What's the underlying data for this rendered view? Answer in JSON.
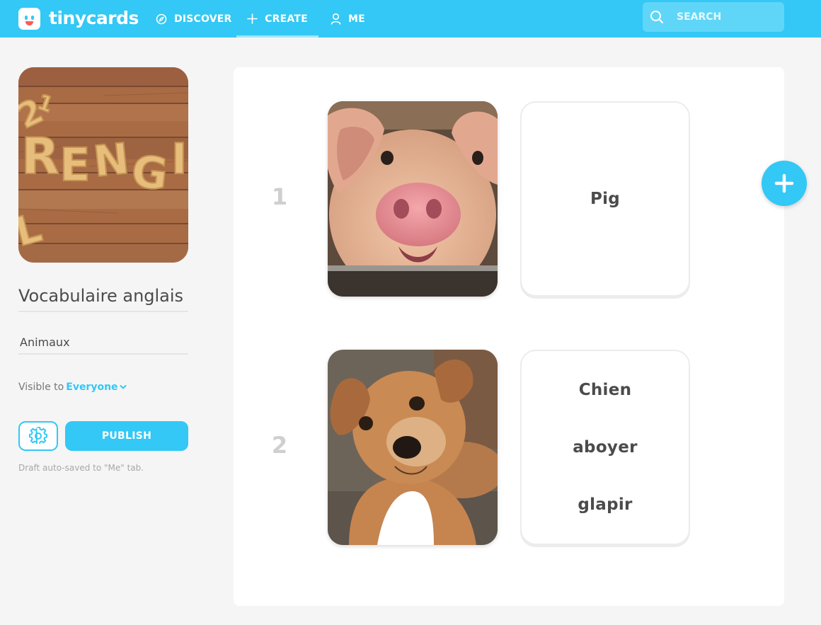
{
  "app": {
    "name": "tinycards"
  },
  "nav": {
    "discover": "DISCOVER",
    "create": "CREATE",
    "me": "ME"
  },
  "search": {
    "placeholder": "SEARCH"
  },
  "deck": {
    "cover_icon": "wooden-letters-english-image",
    "title": "Vocabulaire anglais",
    "description": "Animaux",
    "visible_label": "Visible to",
    "visible_value": "Everyone",
    "publish_label": "PUBLISH",
    "draft_note": "Draft auto-saved to \"Me\" tab."
  },
  "cards": [
    {
      "number": "1",
      "front_image": "pig-photo",
      "back_words": [
        "Pig"
      ]
    },
    {
      "number": "2",
      "front_image": "puppy-photo",
      "back_words": [
        "Chien",
        "aboyer",
        "glapir"
      ]
    }
  ],
  "colors": {
    "accent": "#33c8f5",
    "background": "#f5f5f5"
  }
}
